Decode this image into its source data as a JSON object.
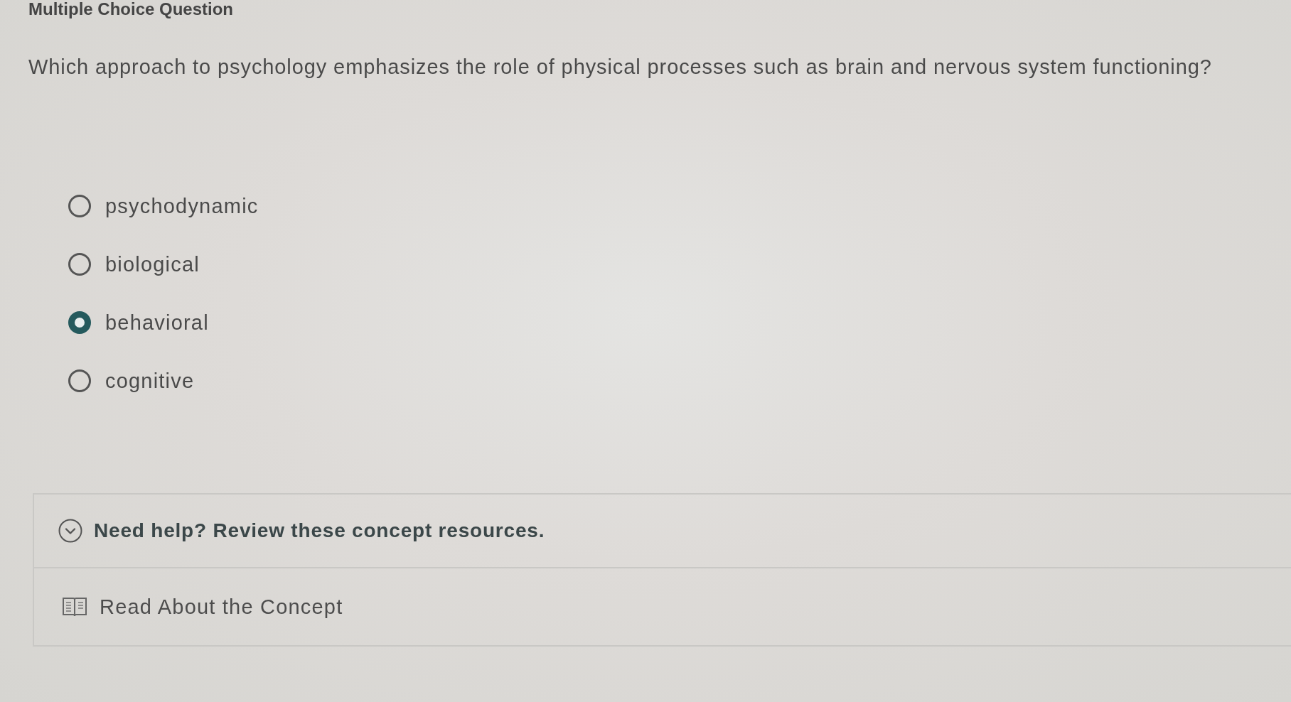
{
  "header": {
    "title": "Multiple Choice Question"
  },
  "question": {
    "text": "Which approach to psychology emphasizes the role of physical processes such as brain and nervous system functioning?"
  },
  "options": [
    {
      "label": "psychodynamic",
      "selected": false
    },
    {
      "label": "biological",
      "selected": false
    },
    {
      "label": "behavioral",
      "selected": true
    },
    {
      "label": "cognitive",
      "selected": false
    }
  ],
  "help_panel": {
    "title": "Need help? Review these concept resources.",
    "resources": [
      {
        "label": "Read About the Concept"
      }
    ]
  }
}
